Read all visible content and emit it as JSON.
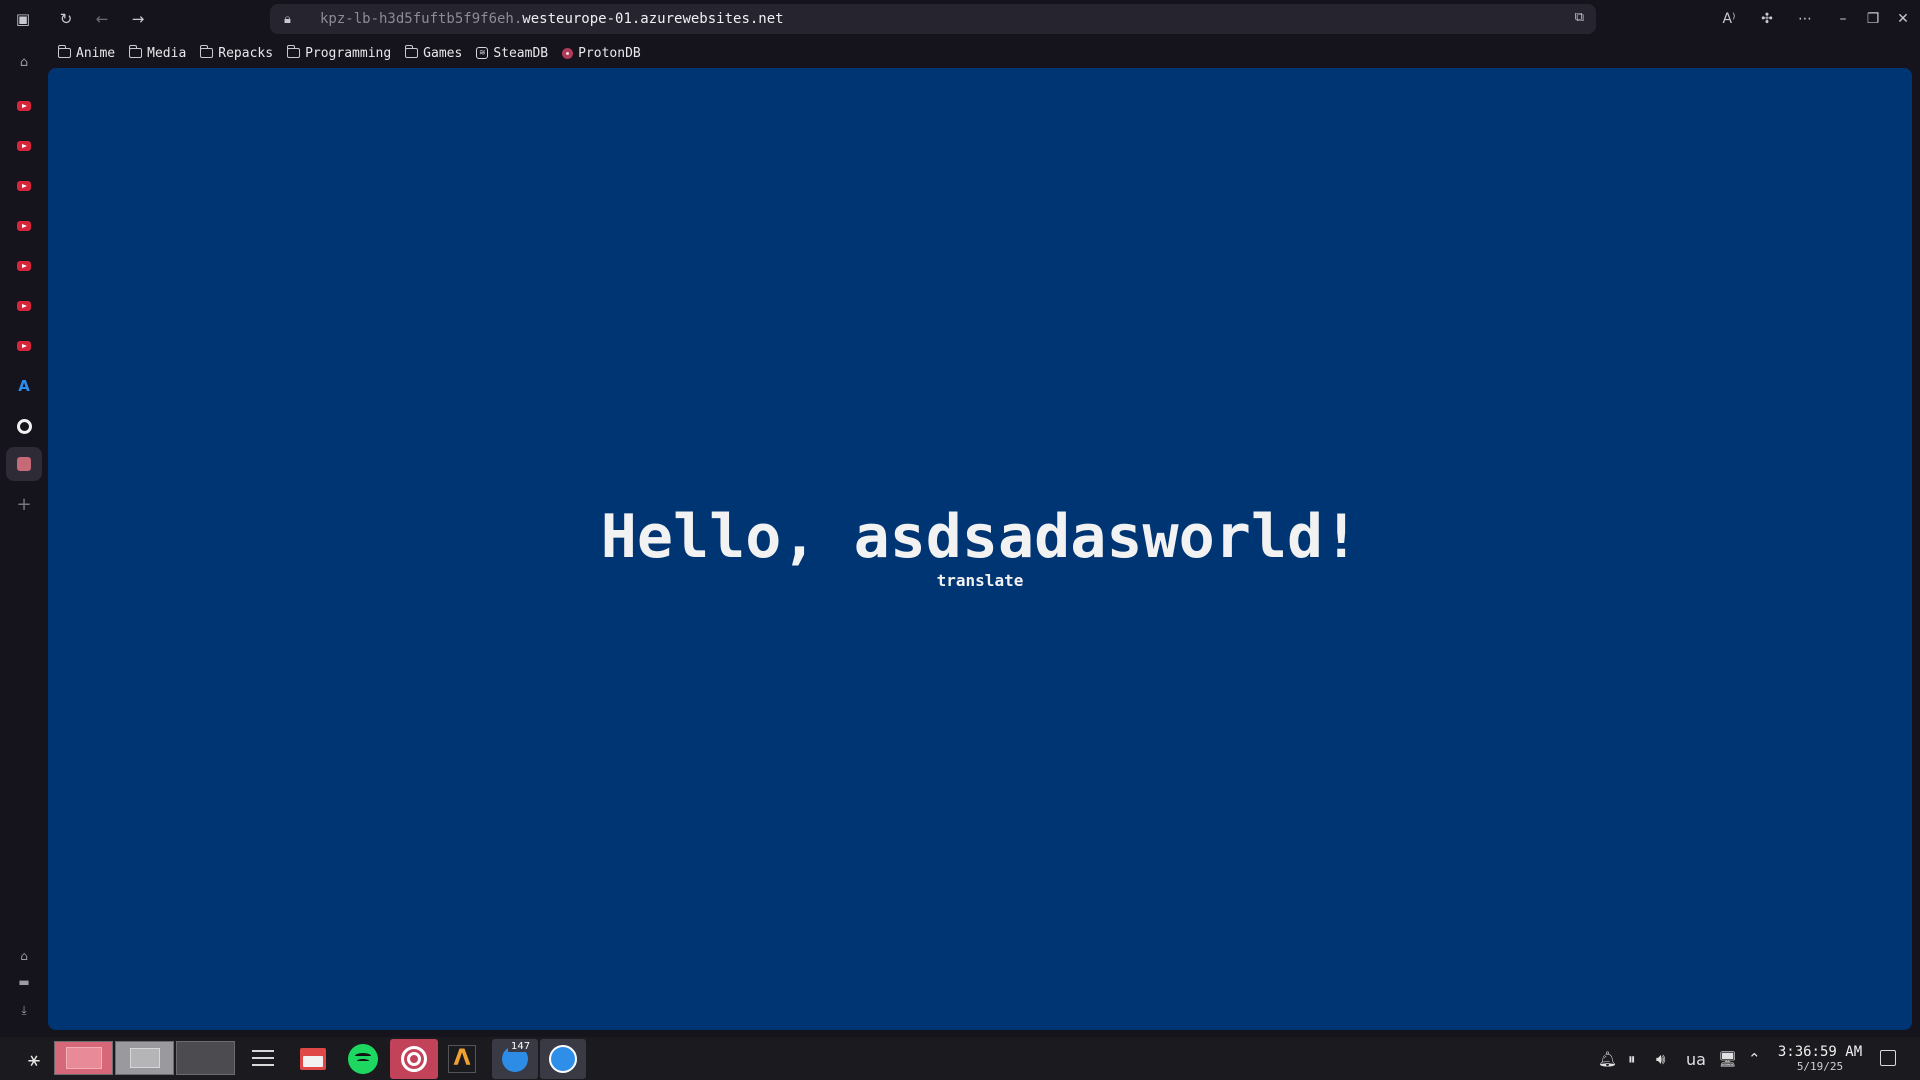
{
  "browser": {
    "url_subdomain": "kpz-lb-h3d5fuftb5f9f6eh.",
    "url_domain": "westeurope-01.azurewebsites.net"
  },
  "bookmarks": [
    {
      "label": "Anime",
      "icon": "folder-icon"
    },
    {
      "label": "Media",
      "icon": "folder-icon"
    },
    {
      "label": "Repacks",
      "icon": "folder-icon"
    },
    {
      "label": "Programming",
      "icon": "folder-icon"
    },
    {
      "label": "Games",
      "icon": "folder-icon"
    },
    {
      "label": "SteamDB",
      "icon": "steamdb-icon"
    },
    {
      "label": "ProtonDB",
      "icon": "protondb-icon"
    }
  ],
  "page": {
    "heading": "Hello, asdsadasworld!",
    "link": "translate",
    "background": "#003574"
  },
  "taskbar": {
    "thunderbird_badge": "147",
    "keyboard_layout": "ua",
    "time": "3:36:59 AM",
    "date": "5/19/25"
  },
  "colors": {
    "accent": "#c2425a",
    "youtube": "#d6243a",
    "spotify": "#1ed760"
  }
}
